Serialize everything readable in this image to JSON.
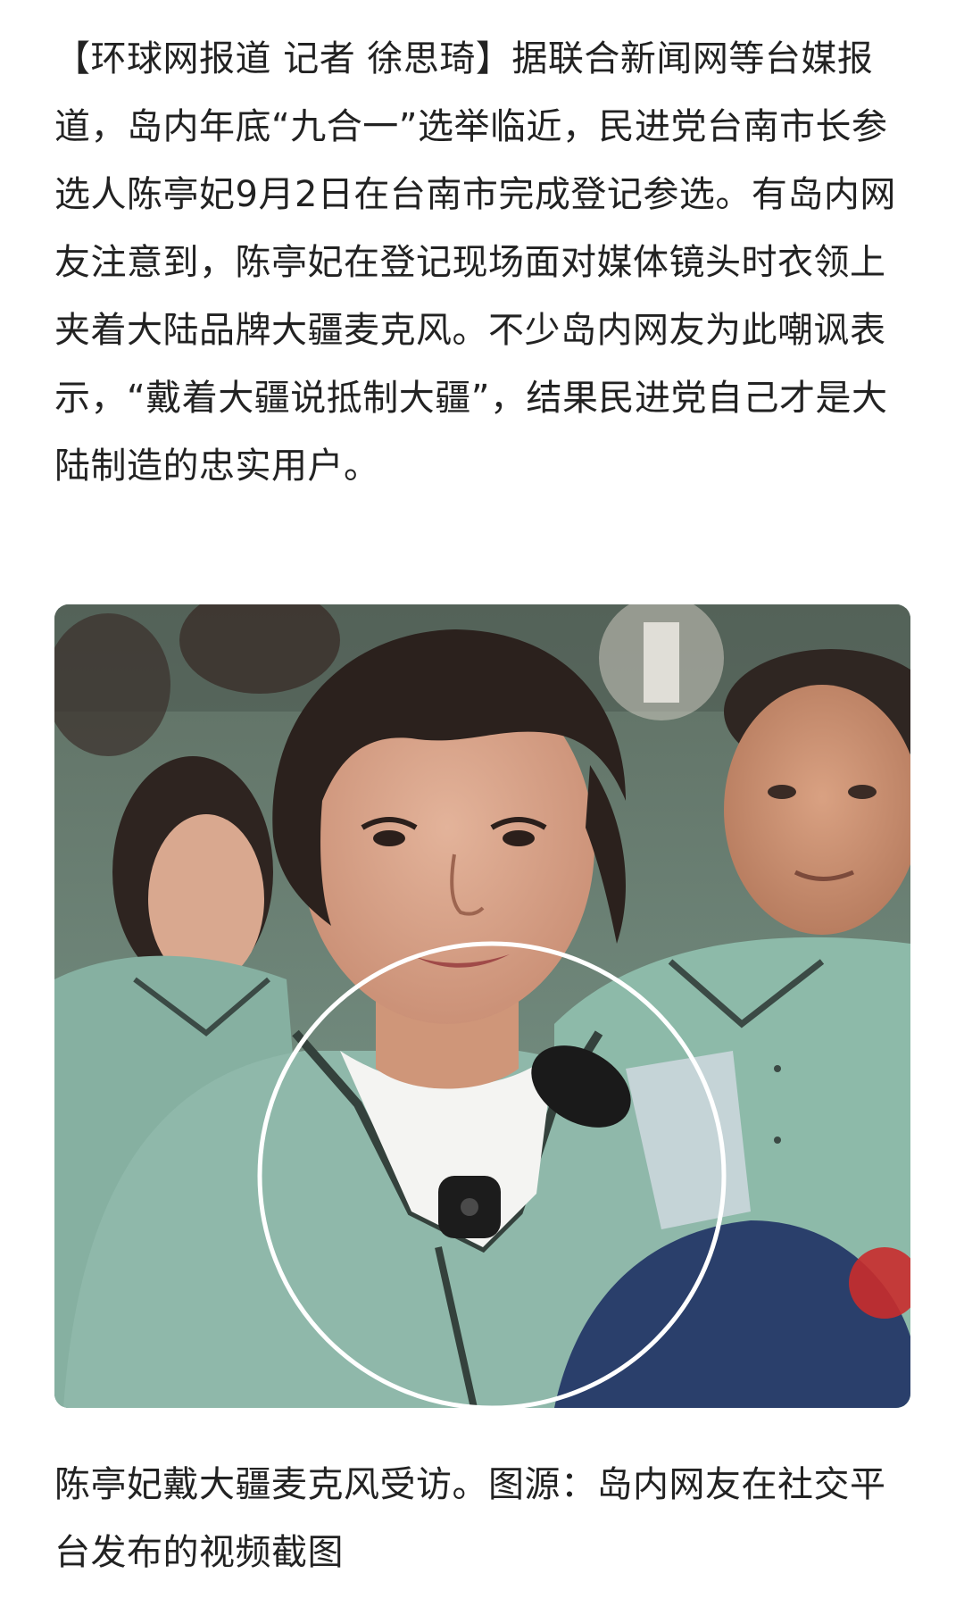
{
  "article": {
    "paragraph": "【环球网报道 记者 徐思琦】据联合新闻网等台媒报道，岛内年底“九合一”选举临近，民进党台南市长参选人陈亭妃9月2日在台南市完成登记参选。有岛内网友注意到，陈亭妃在登记现场面对媒体镜头时衣领上夹着大陆品牌大疆麦克风。不少岛内网友为此嘲讽表示，“戴着大疆说抵制大疆”，结果民进党自己才是大陆制造的忠实用户。"
  },
  "figure": {
    "caption": "陈亭妃戴大疆麦克风受访。图源：岛内网友在社交平台发布的视频截图"
  },
  "colors": {
    "text": "#222222",
    "background": "#ffffff",
    "shirt_green": "#8fb8aa",
    "highlight_circle": "#ffffff"
  }
}
